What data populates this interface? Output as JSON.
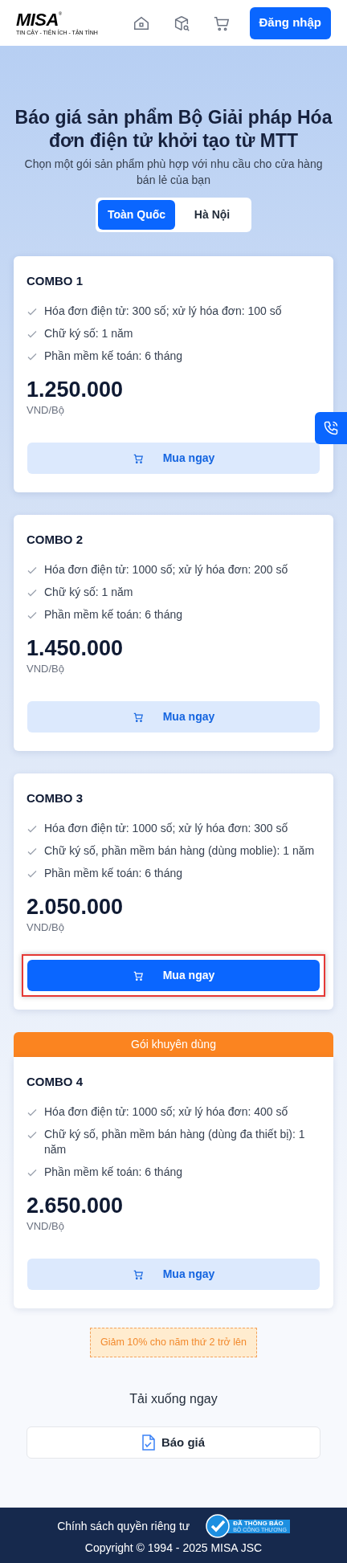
{
  "header": {
    "logo": {
      "wordmark": "MISA",
      "registered": "®",
      "tagline": "TIN CẬY - TIỆN ÍCH - TẬN TÌNH"
    },
    "login_button": "Đăng nhập"
  },
  "hero": {
    "title": "Báo giá sản phẩm Bộ Giải pháp Hóa đơn điện tử khởi tạo từ MTT",
    "subtitle": "Chọn một gói sản phẩm phù hợp với nhu cầu cho cửa hàng bán lẻ của bạn"
  },
  "tabs": [
    {
      "label": "Toàn Quốc",
      "selected": true
    },
    {
      "label": "Hà Nội",
      "selected": false
    }
  ],
  "plans": [
    {
      "name": "COMBO 1",
      "features": [
        "Hóa đơn điện tử: 300 số; xử lý hóa đơn: 100 số",
        "Chữ ký số: 1 năm",
        "Phần mềm kế toán: 6 tháng"
      ],
      "price": "1.250.000",
      "unit": "VND/Bộ",
      "button": "Mua ngay",
      "selected": false,
      "highlighted": false
    },
    {
      "name": "COMBO 2",
      "features": [
        "Hóa đơn điện tử: 1000 số; xử lý hóa đơn: 200 số",
        "Chữ ký số: 1 năm",
        "Phần mềm kế toán: 6 tháng"
      ],
      "price": "1.450.000",
      "unit": "VND/Bộ",
      "button": "Mua ngay",
      "selected": false,
      "highlighted": false
    },
    {
      "name": "COMBO 3",
      "features": [
        "Hóa đơn điện tử: 1000 số; xử lý hóa đơn: 300 số",
        "Chữ ký số, phần mềm bán hàng (dùng moblie): 1 năm",
        "Phần mềm kế toán: 6 tháng"
      ],
      "price": "2.050.000",
      "unit": "VND/Bộ",
      "button": "Mua ngay",
      "selected": true,
      "highlighted": true
    },
    {
      "name": "COMBO 4",
      "ribbon": "Gói khuyên dùng",
      "features": [
        "Hóa đơn điện tử: 1000 số; xử lý hóa đơn: 400 số",
        "Chữ ký số, phần mềm bán hàng (dùng đa thiết bị): 1 năm",
        "Phần mềm kế toán: 6 tháng"
      ],
      "price": "2.650.000",
      "unit": "VND/Bộ",
      "button": "Mua ngay",
      "selected": false,
      "highlighted": false
    }
  ],
  "discount": "Giảm 10% cho năm thứ 2 trở lên",
  "download": {
    "title": "Tải xuống ngay",
    "button": "Báo giá"
  },
  "footer": {
    "privacy": "Chính sách quyền riêng tư",
    "badge": {
      "line_1": "ĐÃ THÔNG BÁO",
      "line_2": "BỘ CÔNG THƯƠNG"
    },
    "copyright": "Copyright © 1994 - 2025 MISA JSC"
  }
}
